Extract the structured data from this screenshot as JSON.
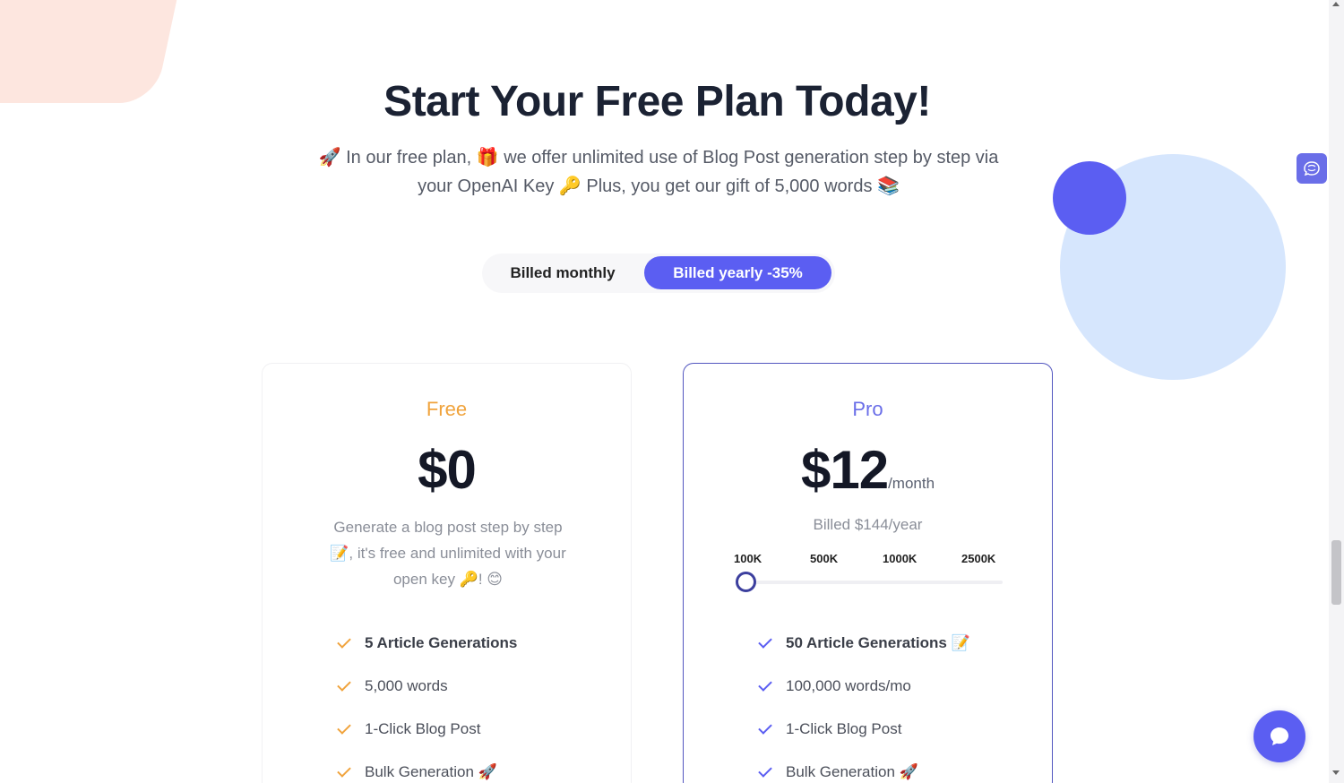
{
  "hero": {
    "title": "Start Your Free Plan Today!",
    "subtitle_line1": "🚀 In our free plan, 🎁 we offer unlimited use of Blog Post generation step by step via",
    "subtitle_line2": "your OpenAI Key 🔑 Plus, you get our gift of 5,000 words 📚"
  },
  "billing_toggle": {
    "monthly_label": "Billed monthly",
    "yearly_label": "Billed yearly -35%",
    "selected": "yearly"
  },
  "plans": {
    "free": {
      "name": "Free",
      "price": "$0",
      "description": "Generate a blog post step by step 📝, it's free and unlimited with your open key 🔑! 😊",
      "features": [
        "5 Article Generations",
        "5,000 words",
        "1-Click Blog Post",
        "Bulk Generation 🚀"
      ]
    },
    "pro": {
      "name": "Pro",
      "price": "$12",
      "price_unit": "/month",
      "billed": "Billed $144/year",
      "slider_ticks": [
        "100K",
        "500K",
        "1000K",
        "2500K"
      ],
      "slider_selected_index": 0,
      "features": [
        "50 Article Generations 📝",
        "100,000 words/mo",
        "1-Click Blog Post",
        "Bulk Generation 🚀"
      ]
    }
  },
  "colors": {
    "accent": "#5b5ef2",
    "free_accent": "#f0a33c",
    "pro_border": "#5357c0"
  },
  "icons": {
    "side_tab": "brain-icon",
    "chat": "chat-bubble-icon",
    "feature_check": "check-icon"
  }
}
